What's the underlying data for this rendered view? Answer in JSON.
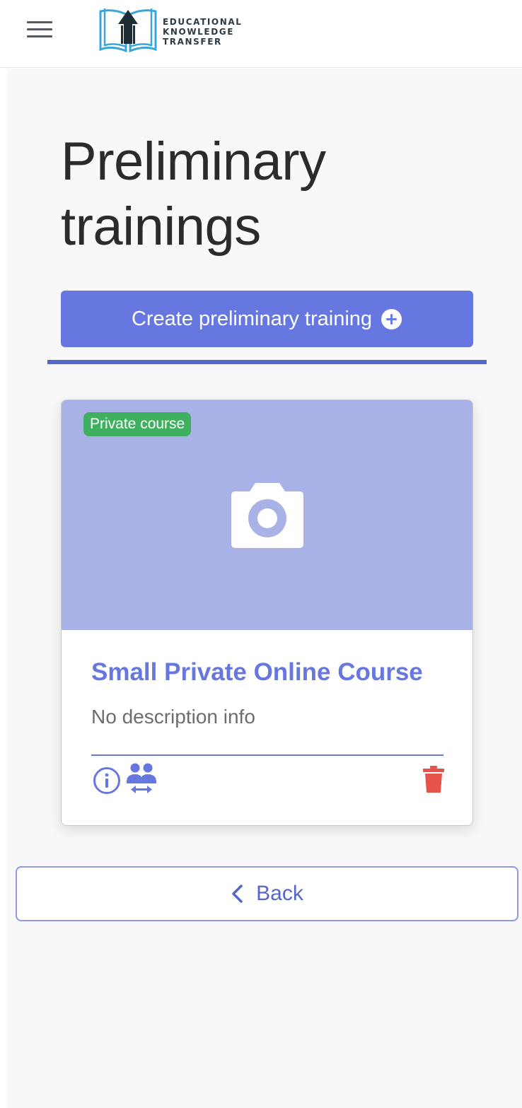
{
  "header": {
    "logo": {
      "line1": "EDUCATIONAL",
      "line2": "KNOWLEDGE",
      "line3": "TRANSFER"
    },
    "menu_icon": "hamburger-menu-icon"
  },
  "page": {
    "title_line1": "Preliminary",
    "title_line2": "trainings"
  },
  "actions": {
    "create_label": "Create preliminary training",
    "create_icon": "plus-circle-icon"
  },
  "courses": [
    {
      "badge": "Private course",
      "title": "Small Private Online Course",
      "description": "No description info",
      "image_placeholder_icon": "camera-icon",
      "action_icons": [
        "info-icon",
        "people-transfer-icon",
        "trash-icon"
      ]
    }
  ],
  "footer": {
    "back_label": "Back",
    "back_icon": "chevron-left-icon"
  },
  "colors": {
    "primary": "#6777e0",
    "primary_dark": "#5565c8",
    "card_image_bg": "#a9b2e6",
    "badge_green": "#3fb060",
    "danger": "#e5534b",
    "page_bg": "#f8f8f8"
  }
}
